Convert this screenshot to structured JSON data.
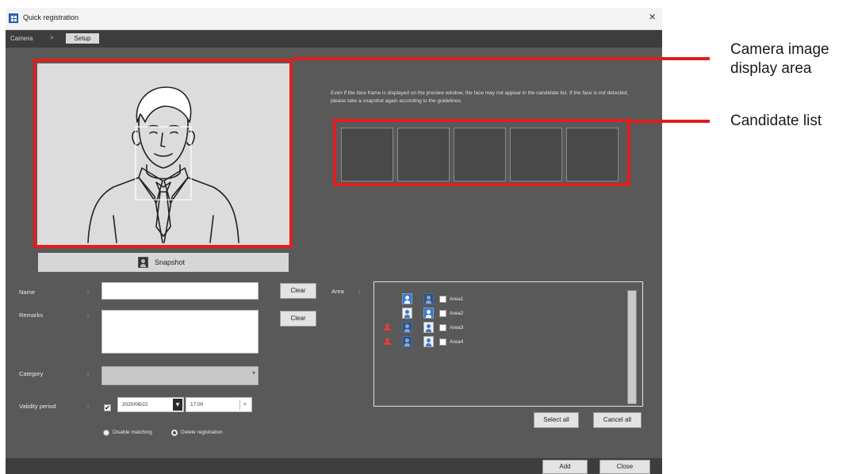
{
  "window": {
    "title": "Quick registration",
    "close_glyph": "×"
  },
  "nav": {
    "camera_label": "Camera",
    "separator": ">",
    "setup_label": "Setup"
  },
  "snapshot": {
    "label": "Snapshot",
    "icon": "person-snapshot-icon"
  },
  "guidance": {
    "text": "Even if the face frame is displayed on the preview window, the face may not appear in the candidate list. If the face is not detected, please take a snapshot again according to the guidelines."
  },
  "candidates": [
    "",
    "",
    "",
    "",
    ""
  ],
  "form": {
    "separator": ":",
    "name_label": "Name",
    "name_value": "",
    "name_clear": "Clear",
    "remarks_label": "Remarks",
    "remarks_value": "",
    "remarks_clear": "Clear",
    "category_label": "Category",
    "category_value": "",
    "validity_label": "Validity period",
    "validity_checked": "✔",
    "validity_date": "2020/06/22",
    "validity_time": "17:00",
    "date_dropdown_glyph": "▾",
    "time_spin_glyph": "÷",
    "radio_disable": "Disable matching",
    "radio_delete": "Delete registration"
  },
  "area": {
    "label": "Area",
    "items": [
      {
        "name": "Area1",
        "alert": false
      },
      {
        "name": "Area2",
        "alert": false
      },
      {
        "name": "Area3",
        "alert": true
      },
      {
        "name": "Area4",
        "alert": true
      }
    ],
    "select_all": "Select all",
    "cancel_all": "Cancel all"
  },
  "footer": {
    "add": "Add",
    "close": "Close"
  },
  "annotations": {
    "camera_area": "Camera image display area",
    "candidate_list": "Candidate list"
  },
  "colors": {
    "highlight_red": "#e21d1d",
    "window_bg": "#595959",
    "accent_blue": "#3a78c8"
  }
}
